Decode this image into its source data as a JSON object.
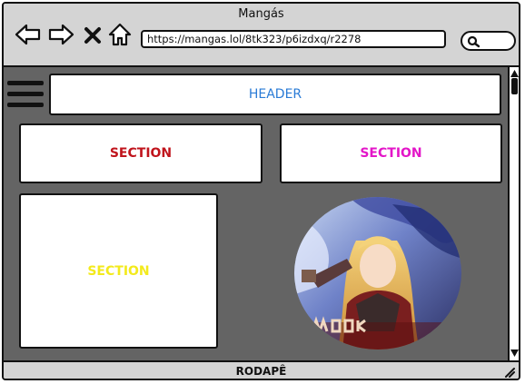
{
  "window": {
    "title": "Mangás"
  },
  "toolbar": {
    "back_icon": "arrow-left-icon",
    "forward_icon": "arrow-right-icon",
    "close_icon": "close-x-icon",
    "home_icon": "home-icon",
    "url": "https://mangas.lol/8tk323/p6izdxq/r2278",
    "search_icon": "search-icon"
  },
  "page": {
    "menu_icon": "hamburger-menu-icon",
    "header_label": "HEADER",
    "sections": [
      {
        "label": "SECTION",
        "color": "#c0141c"
      },
      {
        "label": "SECTION",
        "color": "#e316c8"
      },
      {
        "label": "SECTION",
        "color": "#f3ea1c"
      }
    ],
    "header_color": "#2a7bd6"
  },
  "footer": {
    "label": "RODAPÊ"
  },
  "colors": {
    "canvas": "#646464",
    "chrome": "#d4d4d4"
  }
}
